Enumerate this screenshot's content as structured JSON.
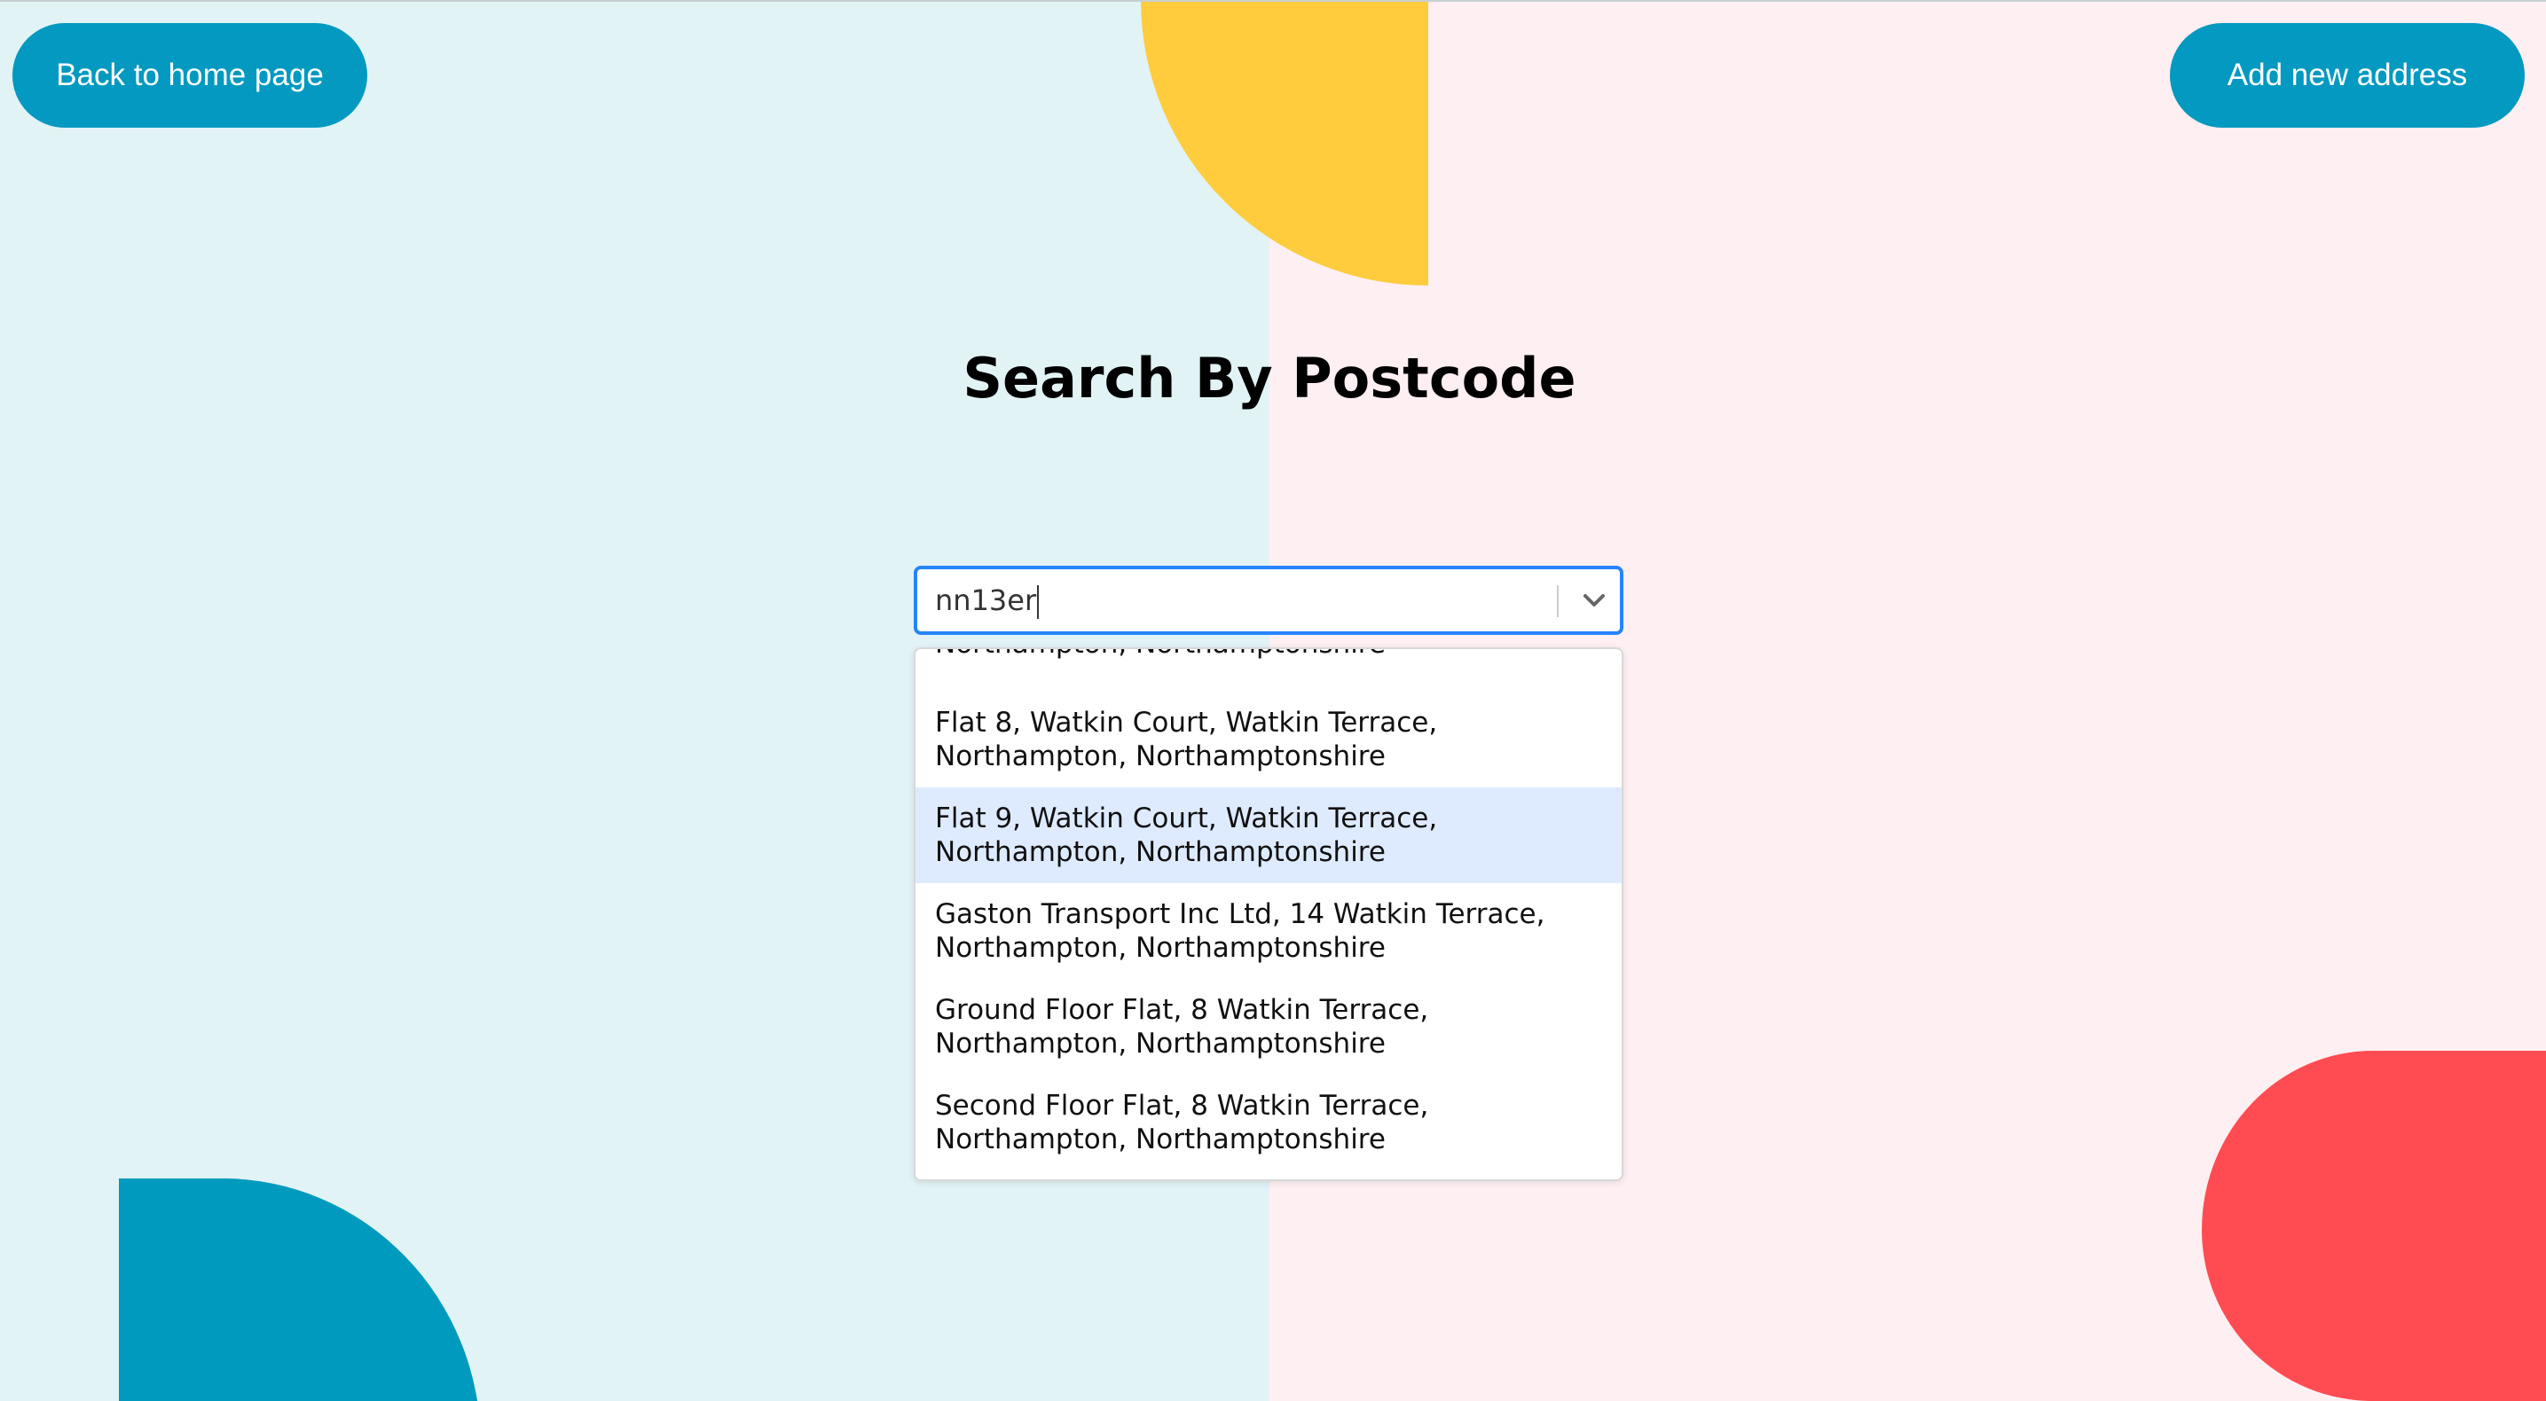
{
  "header": {
    "back_label": "Back to home page",
    "add_label": "Add new address"
  },
  "main": {
    "title": "Search By Postcode"
  },
  "search": {
    "value": "nn13er",
    "dropdown_icon": "chevron-down-icon"
  },
  "dropdown": {
    "options": [
      {
        "line1": "",
        "line2": "Northampton, Northamptonshire"
      },
      {
        "line1": "Flat 8, Watkin Court, Watkin Terrace,",
        "line2": "Northampton, Northamptonshire"
      },
      {
        "line1": "Flat 9, Watkin Court, Watkin Terrace,",
        "line2": "Northampton, Northamptonshire",
        "focused": true
      },
      {
        "line1": "Gaston Transport Inc Ltd, 14 Watkin Terrace,",
        "line2": "Northampton, Northamptonshire"
      },
      {
        "line1": "Ground Floor Flat, 8 Watkin Terrace,",
        "line2": "Northampton, Northamptonshire"
      },
      {
        "line1": "Second Floor Flat, 8 Watkin Terrace,",
        "line2": "Northampton, Northamptonshire"
      }
    ]
  },
  "colors": {
    "background_left": "#e2f3f5",
    "background_right": "#feeff2",
    "button": "#0399c0",
    "accent_yellow": "#ffcc3d",
    "accent_blue": "#019abf",
    "accent_red": "#ff4c52",
    "focus_border": "#2684ff",
    "option_focused": "#deebff"
  }
}
